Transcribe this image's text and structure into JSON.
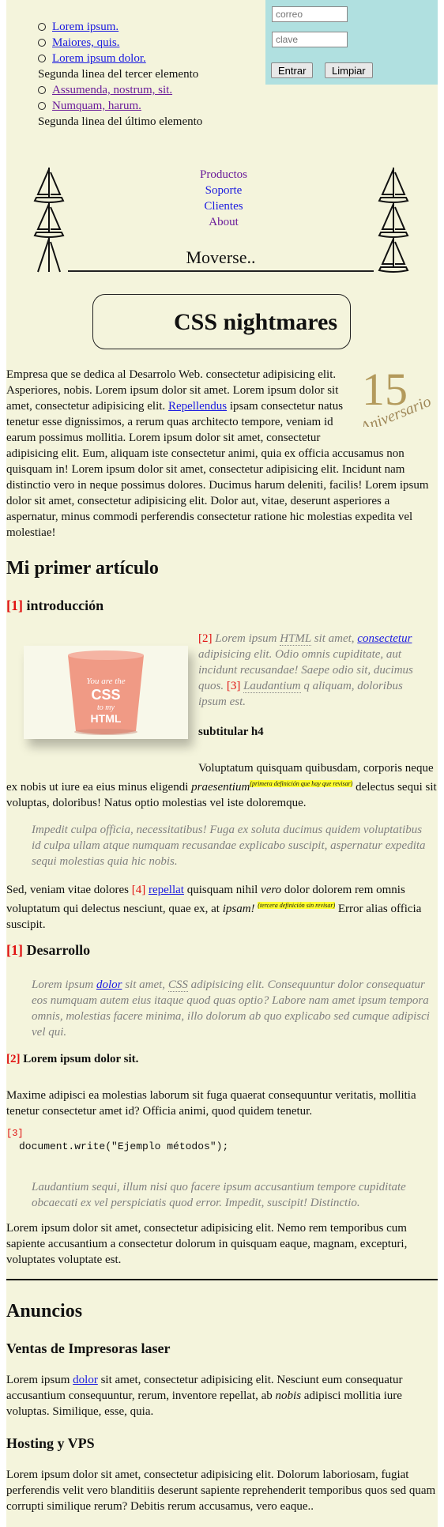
{
  "top_list": {
    "items": [
      {
        "label": "Lorem ipsum."
      },
      {
        "label": "Maiores, quis."
      },
      {
        "label": "Lorem ipsum dolor.",
        "cont": "Segunda linea del tercer elemento"
      },
      {
        "label": "Assumenda, nostrum, sit."
      },
      {
        "label": "Numquam, harum.",
        "cont": "Segunda linea del último elemento"
      }
    ]
  },
  "login": {
    "user_placeholder": "correo",
    "pass_placeholder": "clave",
    "enter_label": "Entrar",
    "clear_label": "Limpiar",
    "bg_color": "#b0e0e0"
  },
  "nav": {
    "items": [
      "Productos",
      "Soporte",
      "Clientes",
      "About"
    ],
    "title": "Moverse.."
  },
  "site_title": "CSS nightmares",
  "anniversary": {
    "number": "15",
    "word": "Aniversario"
  },
  "intro": {
    "t1": "Empresa que se dedica al Desarrolo Web. consectetur adipisicing elit. Asperiores, nobis. Lorem ipsum dolor sit amet. Lorem ipsum dolor sit amet, consectetur adipisicing elit. ",
    "link": "Repellendus",
    "t2": " ipsam consectetur natus tenetur esse dignissimos, a rerum quas architecto tempore, veniam id earum possimus mollitia. Lorem ipsum dolor sit amet, consectetur adipisicing elit. Eum, aliquam iste consectetur animi, quia ex officia accusamus non quisquam in! Lorem ipsum dolor sit amet, consectetur adipisicing elit. Incidunt nam distinctio vero in neque possimus dolores. Ducimus harum deleniti, facilis! Lorem ipsum dolor sit amet, consectetur adipisicing elit. Dolor aut, vitae, deserunt asperiores a aspernatur, minus commodi perferendis consectetur ratione hic molestias expedita vel molestiae!"
  },
  "article": {
    "title": "Mi primer artículo",
    "intro_num": "[1]",
    "intro_title": "introducción",
    "cup": {
      "line1": "You are the",
      "line2": "CSS",
      "line3": "to my",
      "line4": "HTML"
    },
    "q1": {
      "n1": "[2]",
      "t1": " Lorem ipsum ",
      "abbr1": "HTML",
      "t2": " sit amet, ",
      "link": "consectetur",
      "t3": " adipisicing elit. Odio omnis cupiditate, aut incidunt recusandae! Saepe odio sit, ducimus quos. ",
      "n2": "[3]",
      "abbr2": "Laudantium",
      "t4": " q aliquam, doloribus ipsum est."
    },
    "subtitle": "subtitular h4",
    "p1": {
      "t1": "Voluptatum quisquam quibusdam, corporis neque ex nobis ut iure ea eius minus eligendi ",
      "em": "praesentium",
      "note": "(primera definición que hay que revisar)",
      "t2": " delectus sequi sit voluptas, doloribus! Natus optio molestias vel iste doloremque."
    },
    "q2": "Impedit culpa officia, necessitatibus! Fuga ex soluta ducimus quidem voluptatibus id culpa ullam atque numquam recusandae explicabo suscipit, aspernatur expedita sequi molestias quia hic nobis.",
    "p2": {
      "t1": "Sed, veniam vitae dolores ",
      "num": "[4]",
      "link": "repellat",
      "t2": " quisquam nihil ",
      "em1": "vero",
      "t3": " dolor dolorem rem omnis voluptatum qui delectus nesciunt, quae ex, at ",
      "em2": "ipsam!",
      "note": "(tercera definición sin revisar)",
      "t4": " Error alias officia suscipit."
    },
    "dev_num": "[1]",
    "dev_title": "Desarrollo",
    "q3": {
      "t1": "Lorem ipsum ",
      "link": "dolor",
      "t2": " sit amet, ",
      "abbr": "CSS",
      "t3": " adipisicing elit. Consequuntur dolor consequatur eos numquam autem eius itaque quod quas optio? Labore nam amet ipsum tempora omnis, molestias facere minima, illo dolorum ab quo explicabo sed cumque adipisci vel qui."
    },
    "lorem_num": "[2]",
    "lorem_title": "Lorem ipsum dolor sit.",
    "p3": "Maxime adipisci ea molestias laborum sit fuga quaerat consequuntur veritatis, mollitia tenetur consectetur amet id? Officia animi, quod quidem tenetur.",
    "code_num": "[3]",
    "code": "document.write(\"Ejemplo métodos\");",
    "q4": "Laudantium sequi, illum nisi quo facere ipsum accusantium tempore cupiditate obcaecati ex vel perspiciatis quod error. Impedit, suscipit! Distinctio.",
    "p4": "Lorem ipsum dolor sit amet, consectetur adipisicing elit. Nemo rem temporibus cum sapiente accusantium a consectetur dolorum in quisquam eaque, magnam, excepturi, voluptates voluptate est."
  },
  "ads": {
    "title": "Anuncios",
    "s1_title": "Ventas de Impresoras laser",
    "s1": {
      "t1": "Lorem ipsum ",
      "link": "dolor",
      "t2": " sit amet, consectetur adipisicing elit. Nesciunt eum consequatur accusantium consequuntur, rerum, inventore repellat, ab ",
      "em": "nobis",
      "t3": " adipisci mollitia iure voluptas. Similique, esse, quia."
    },
    "s2_title": "Hosting y VPS",
    "s2": "Lorem ipsum dolor sit amet, consectetur adipisicing elit. Dolorum laboriosam, fugiat perferendis velit vero blanditiis deserunt sapiente reprehenderit temporibus quos sed quam corrupti similique rerum? Debitis rerum accusamus, vero eaque.."
  },
  "colors": {
    "page_bg": "#f4f4dc",
    "link": "#1a1ae0",
    "visited": "#6a1b9a",
    "marker": "#e01010",
    "highlight": "#ffff30"
  }
}
